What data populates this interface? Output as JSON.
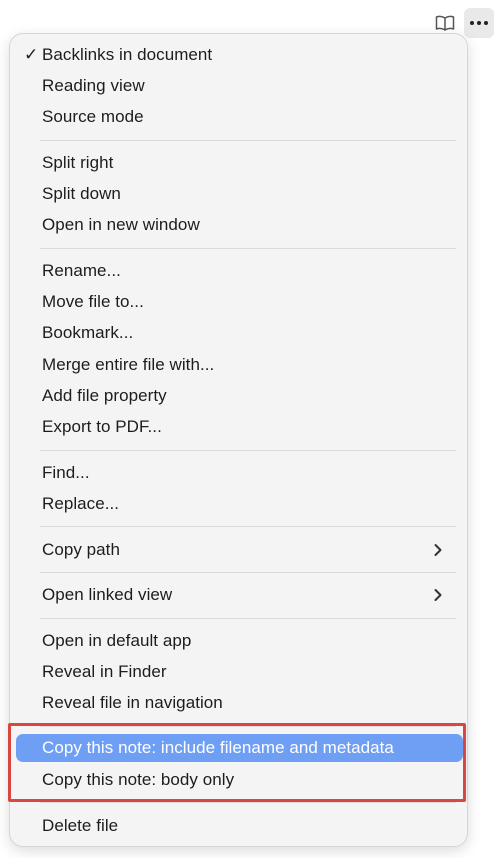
{
  "topbar": {
    "reading_icon": "book-open-icon",
    "more_icon": "more-horizontal-icon"
  },
  "menu": {
    "check_glyph": "✓",
    "items": [
      {
        "label": "Backlinks in document",
        "checked": true
      },
      {
        "label": "Reading view"
      },
      {
        "label": "Source mode"
      },
      {
        "label": "Split right"
      },
      {
        "label": "Split down"
      },
      {
        "label": "Open in new window"
      },
      {
        "label": "Rename..."
      },
      {
        "label": "Move file to..."
      },
      {
        "label": "Bookmark..."
      },
      {
        "label": "Merge entire file with..."
      },
      {
        "label": "Add file property"
      },
      {
        "label": "Export to PDF..."
      },
      {
        "label": "Find..."
      },
      {
        "label": "Replace..."
      },
      {
        "label": "Copy path",
        "submenu": true
      },
      {
        "label": "Open linked view",
        "submenu": true
      },
      {
        "label": "Open in default app"
      },
      {
        "label": "Reveal in Finder"
      },
      {
        "label": "Reveal file in navigation"
      },
      {
        "label": "Copy this note: include filename and metadata",
        "active": true
      },
      {
        "label": "Copy this note: body only"
      },
      {
        "label": "Delete file"
      }
    ]
  },
  "colors": {
    "active_bg": "#6e9ff5",
    "highlight_border": "#d7483e"
  }
}
